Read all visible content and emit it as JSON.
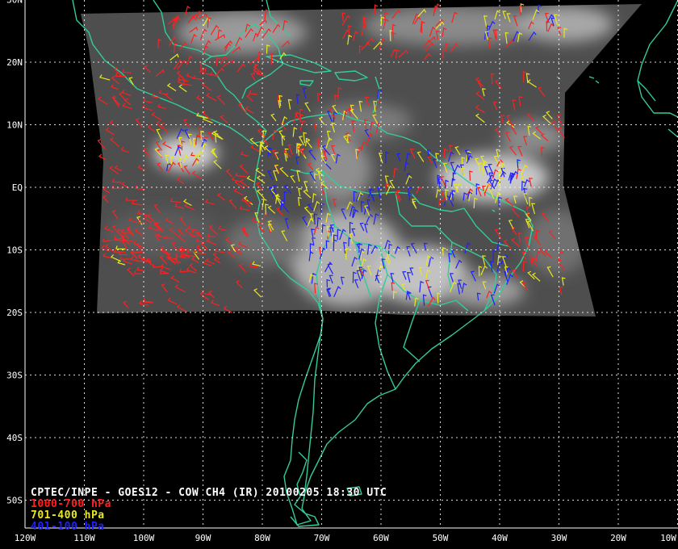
{
  "title": "CPTEC/INPE - GOES12 - COW CH4 (IR) 20100205 18:30 UTC",
  "legend": [
    {
      "label": "1000-700 hPa",
      "color": "#ff2020"
    },
    {
      "label": "701-400 hPa",
      "color": "#e8e820"
    },
    {
      "label": "401-100 hPa",
      "color": "#2020ff"
    }
  ],
  "latitude_labels": [
    {
      "text": "30N",
      "lat": 30
    },
    {
      "text": "20N",
      "lat": 20
    },
    {
      "text": "10N",
      "lat": 10
    },
    {
      "text": "EQ",
      "lat": 0
    },
    {
      "text": "10S",
      "lat": -10
    },
    {
      "text": "20S",
      "lat": -20
    },
    {
      "text": "30S",
      "lat": -30
    },
    {
      "text": "40S",
      "lat": -40
    },
    {
      "text": "50S",
      "lat": -50
    }
  ],
  "longitude_labels": [
    {
      "text": "120W",
      "lon": -120
    },
    {
      "text": "110W",
      "lon": -110
    },
    {
      "text": "100W",
      "lon": -100
    },
    {
      "text": "90W",
      "lon": -90
    },
    {
      "text": "80W",
      "lon": -80
    },
    {
      "text": "70W",
      "lon": -70
    },
    {
      "text": "60W",
      "lon": -60
    },
    {
      "text": "50W",
      "lon": -50
    },
    {
      "text": "40W",
      "lon": -40
    },
    {
      "text": "30W",
      "lon": -30
    },
    {
      "text": "20W",
      "lon": -20
    },
    {
      "text": "10W",
      "lon": -10
    }
  ],
  "colors": {
    "background": "#000000",
    "coastline": "#33cc99",
    "grid": "#ffffff",
    "satellite": "#555555"
  }
}
